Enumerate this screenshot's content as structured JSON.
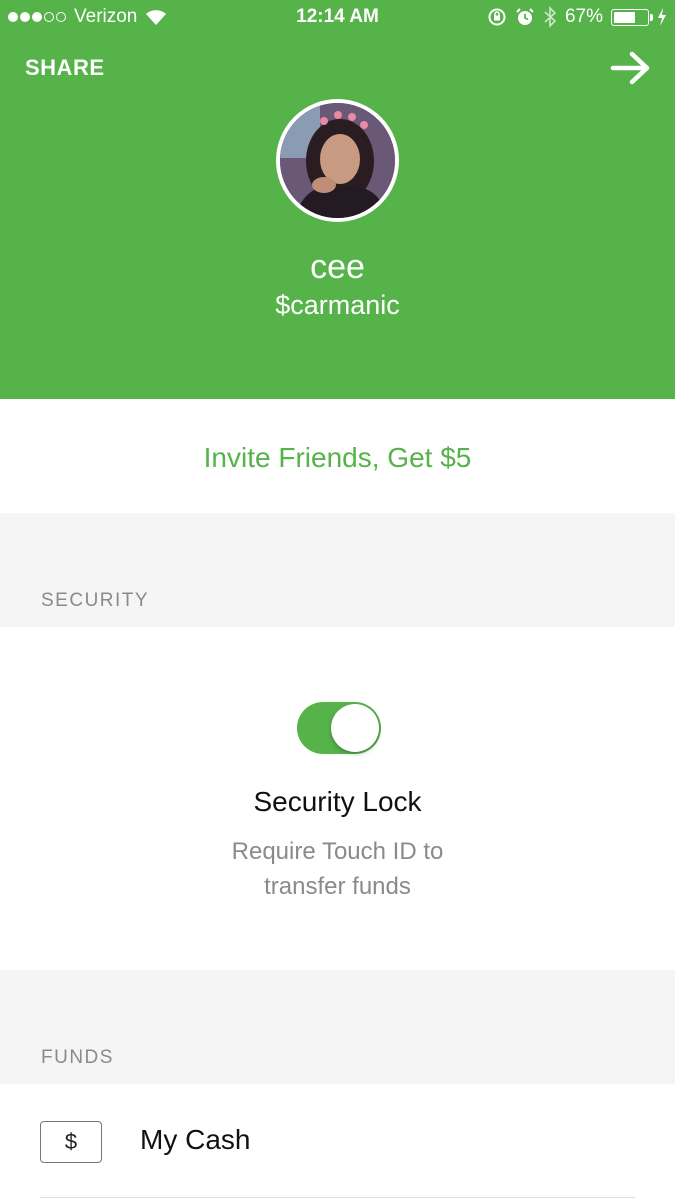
{
  "status_bar": {
    "carrier": "Verizon",
    "time": "12:14 AM",
    "battery": "67%",
    "battery_level": 0.67,
    "signal_bars": 3,
    "signal_total": 5
  },
  "header": {
    "share_label": "SHARE",
    "background_color": "#55b34a"
  },
  "profile": {
    "name": "cee",
    "cashtag": "$carmanic"
  },
  "invite": {
    "label": "Invite Friends, Get $5",
    "color": "#55b34a"
  },
  "security": {
    "section_label": "SECURITY",
    "toggle_on": true,
    "title": "Security Lock",
    "description_line1": "Require Touch ID to",
    "description_line2": "transfer funds"
  },
  "funds": {
    "section_label": "FUNDS",
    "icon_symbol": "$",
    "item_label": "My Cash"
  }
}
